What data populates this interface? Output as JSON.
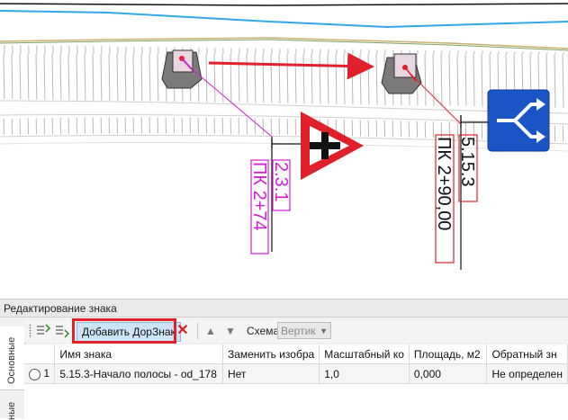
{
  "canvas": {
    "sign_2_3_1_label": "2.3.1",
    "pk_left_label": "ПК 2+74",
    "sign_5_15_3_label": "5.15.3",
    "pk_right_label": "ПК 2+90,00"
  },
  "panel": {
    "title": "Редактирование знака",
    "tabs": {
      "main": "Основные",
      "other": "ные"
    },
    "toolbar": {
      "add_label": "Добавить ДорЗнак",
      "scheme_label": "Схема",
      "scheme_value": "Вертик"
    },
    "table": {
      "columns": [
        "Имя знака",
        "Заменить изобра",
        "Масштабный ко",
        "Площадь, м2",
        "Обратный зн"
      ],
      "rows": [
        {
          "num": "1",
          "name": "5.15.3-Начало полосы - od_178",
          "replace": "Нет",
          "scale": "1,0",
          "area": "0,000",
          "reverse": "Не определен"
        }
      ]
    }
  },
  "colors": {
    "accent_red": "#e0202a",
    "magenta": "#d21fd2",
    "sign_blue": "#1a55c8"
  }
}
